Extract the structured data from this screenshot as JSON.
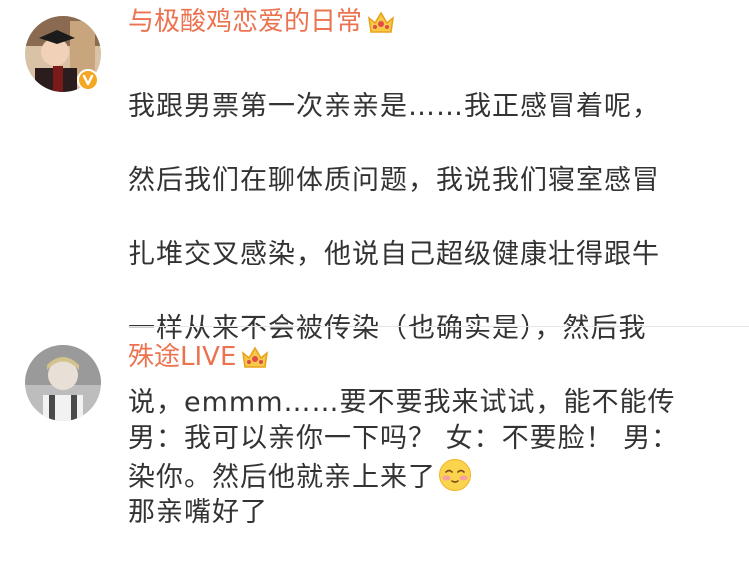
{
  "comments": [
    {
      "username": "与极酸鸡恋爱的日常",
      "verified": true,
      "lines": [
        "我跟男票第一次亲亲是……我正感冒着呢，",
        "然后我们在聊体质问题，我说我们寝室感冒",
        "扎堆交叉感染，他说自己超级健康壮得跟牛",
        "一样从来不会被传染（也确实是），然后我",
        "说，emmm……要不要我来试试，能不能传",
        "染你。然后他就亲上来了"
      ],
      "emoji": "shy-smile-emoji"
    },
    {
      "username": "殊途LIVE",
      "verified": false,
      "lines": [
        "男：我可以亲你一下吗？ 女：不要脸！ 男：",
        "那亲嘴好了"
      ]
    }
  ],
  "colors": {
    "username": "#eb7350",
    "text": "#333333",
    "verified": "#f5a623",
    "divider": "#e6e6e6"
  }
}
